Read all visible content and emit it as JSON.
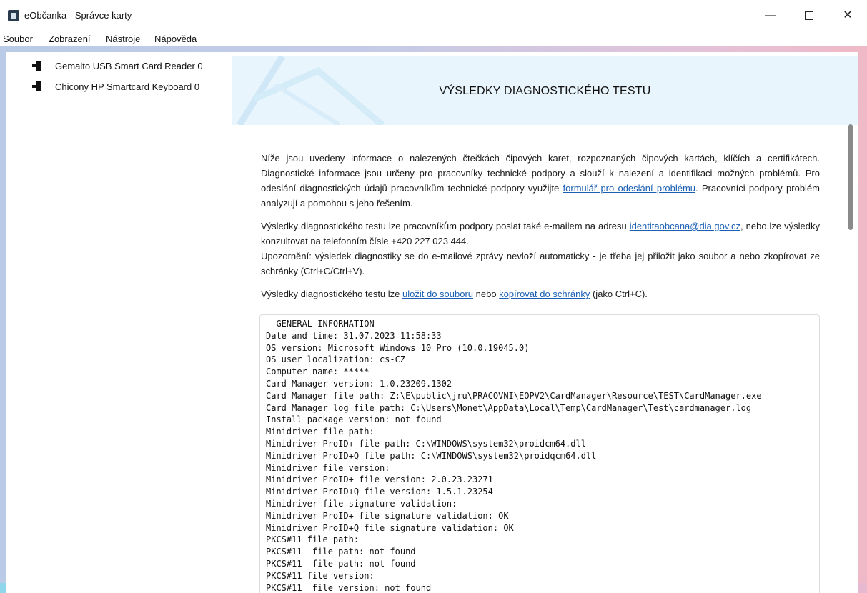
{
  "window": {
    "title": "eObčanka - Správce karty",
    "minimize": "—",
    "close": "✕"
  },
  "menu": [
    "Soubor",
    "Zobrazení",
    "Nástroje",
    "Nápověda"
  ],
  "sidebar": {
    "readers": [
      {
        "label": "Gemalto USB Smart Card Reader 0",
        "icon": "card-reader-icon"
      },
      {
        "label": "Chicony HP Smartcard Keyboard 0",
        "icon": "card-reader-icon"
      }
    ]
  },
  "content": {
    "title": "VÝSLEDKY DIAGNOSTICKÉHO TESTU",
    "p1_text": "Níže jsou uvedeny informace o nalezených čtečkách čipových karet, rozpoznaných čipových kartách, klíčích a certifikátech. Diagnostické informace jsou určeny pro pracovníky technické podpory a slouží k nalezení a identifikaci možných problémů. Pro odeslání diagnostických údajů pracovníkům technické podpory využijte ",
    "p1_link": "formulář pro odeslání problému",
    "p1_end": ". Pracovníci podpory problém analyzují a pomohou s jeho řešením.",
    "p2_text": "Výsledky diagnostického testu lze pracovníkům podpory poslat také e-mailem na adresu ",
    "p2_email": "identitaobcana@dia.gov.cz",
    "p2_end": ", nebo lze výsledky konzultovat na telefonním čísle +420 227 023 444.",
    "p3_text": "Upozornění: výsledek diagnostiky se do e-mailové zprávy nevloží automaticky - je třeba jej přiložit jako soubor a nebo zkopírovat ze schránky (Ctrl+C/Ctrl+V).",
    "p4_text": "Výsledky diagnostického testu lze ",
    "p4_link1": "uložit do souboru",
    "p4_mid": " nebo ",
    "p4_link2": "kopírovat do schránky",
    "p4_end": " (jako Ctrl+C).",
    "log": [
      "- GENERAL INFORMATION -------------------------------",
      "Date and time: 31.07.2023 11:58:33",
      "OS version: Microsoft Windows 10 Pro (10.0.19045.0)",
      "OS user localization: cs-CZ",
      "Computer name: *****",
      "Card Manager version: 1.0.23209.1302",
      "Card Manager file path: Z:\\E\\public\\jru\\PRACOVNI\\EOPV2\\CardManager\\Resource\\TEST\\CardManager.exe",
      "Card Manager log file path: C:\\Users\\Monet\\AppData\\Local\\Temp\\CardManager\\Test\\cardmanager.log",
      "Install package version: not found",
      "Minidriver file path:",
      "Minidriver ProID+ file path: C:\\WINDOWS\\system32\\proidcm64.dll",
      "Minidriver ProID+Q file path: C:\\WINDOWS\\system32\\proidqcm64.dll",
      "Minidriver file version:",
      "Minidriver ProID+ file version: 2.0.23.23271",
      "Minidriver ProID+Q file version: 1.5.1.23254",
      "Minidriver file signature validation:",
      "Minidriver ProID+ file signature validation: OK",
      "Minidriver ProID+Q file signature validation: OK",
      "PKCS#11 file path:",
      "PKCS#11  file path: not found",
      "PKCS#11  file path: not found",
      "PKCS#11 file version:",
      "PKCS#11  file version: not found"
    ]
  }
}
